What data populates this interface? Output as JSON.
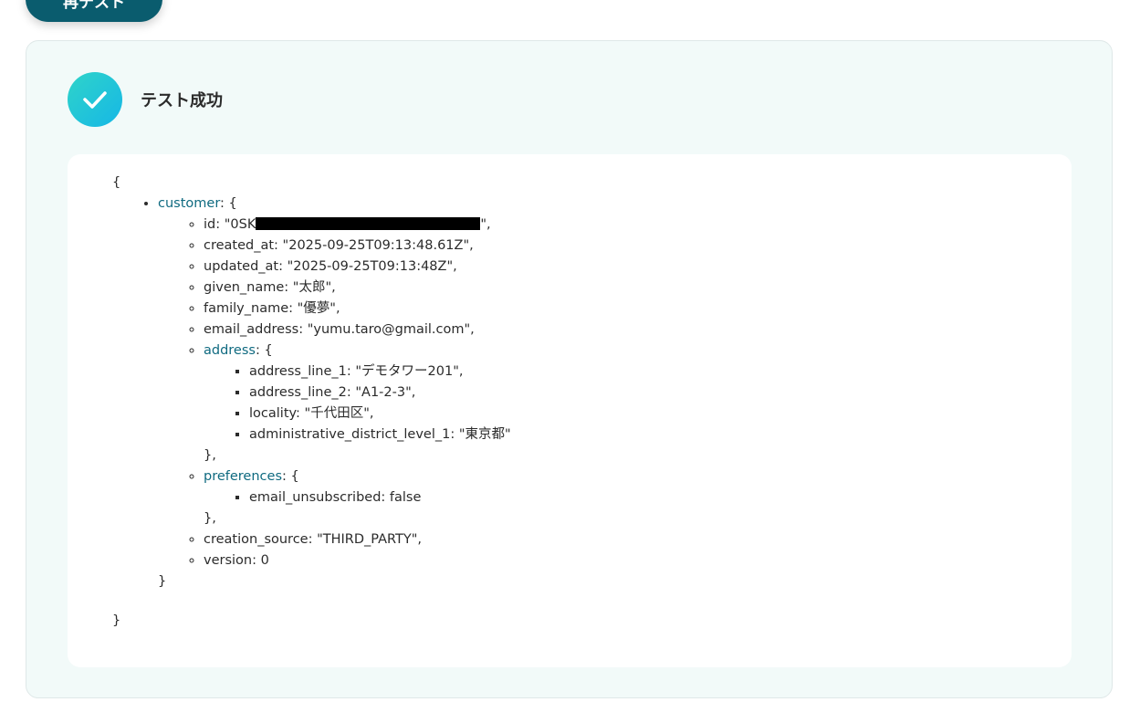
{
  "toolbar": {
    "retest_label": "再テスト"
  },
  "status": {
    "title": "テスト成功",
    "icon": "check-icon",
    "accent_gradient": [
      "#2fd4c9",
      "#16b7e6"
    ]
  },
  "json": {
    "open_brace": "{",
    "close_brace": "}",
    "customer": {
      "key": "customer",
      "open": ": {",
      "close": "}",
      "id": {
        "label": "id: \"0SK",
        "suffix": "\",",
        "redacted": true
      },
      "created_at": "created_at: \"2025-09-25T09:13:48.61Z\",",
      "updated_at": "updated_at: \"2025-09-25T09:13:48Z\",",
      "given_name": "given_name: \"太郎\",",
      "family_name": "family_name: \"優夢\",",
      "email_address": "email_address: \"yumu.taro@gmail.com\",",
      "address": {
        "key": "address",
        "open": ": {",
        "close": "},",
        "line_1": "address_line_1: \"デモタワー201\",",
        "line_2": "address_line_2: \"A1-2-3\",",
        "locality": "locality: \"千代田区\",",
        "district": "administrative_district_level_1: \"東京都\""
      },
      "preferences": {
        "key": "preferences",
        "open": ": {",
        "close": "},",
        "email_unsubscribed": "email_unsubscribed: false"
      },
      "creation_source": "creation_source: \"THIRD_PARTY\",",
      "version": "version: 0"
    }
  }
}
